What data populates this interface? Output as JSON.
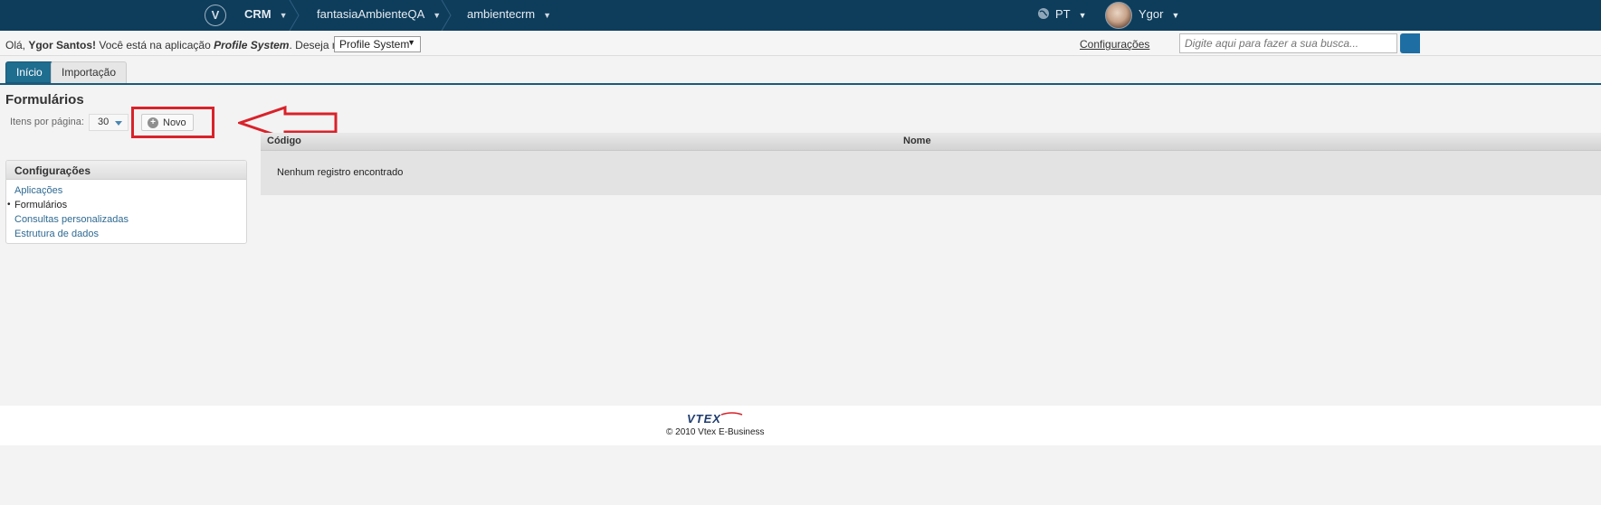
{
  "topbar": {
    "logo_letter": "V",
    "breadcrumbs": [
      {
        "label": "CRM"
      },
      {
        "label": "fantasiaAmbienteQA"
      },
      {
        "label": "ambientecrm"
      }
    ],
    "language": "PT",
    "user_name": "Ygor",
    "chevron": "⌄"
  },
  "infobar": {
    "greeting_prefix": "Olá, ",
    "user_full_name": "Ygor Santos!",
    "greeting_mid": " Você está na aplicação ",
    "app_name": "Profile System",
    "greeting_suffix": ". Deseja mudar?",
    "app_select_value": "Profile System",
    "config_link": "Configurações",
    "search_placeholder": "Digite aqui para fazer a sua busca..."
  },
  "tabs": [
    {
      "label": "Início",
      "active": true
    },
    {
      "label": "Importação",
      "active": false
    }
  ],
  "main": {
    "title": "Formulários",
    "per_page_label": "Itens por página:",
    "per_page_value": "30",
    "new_button": "Novo"
  },
  "sidebar": {
    "title": "Configurações",
    "items": [
      {
        "label": "Aplicações",
        "current": false
      },
      {
        "label": "Formulários",
        "current": true
      },
      {
        "label": "Consultas personalizadas",
        "current": false
      },
      {
        "label": "Estrutura de dados",
        "current": false
      }
    ]
  },
  "table": {
    "columns": [
      "Código",
      "Nome"
    ],
    "empty_message": "Nenhum registro encontrado"
  },
  "footer": {
    "logo_text": "VTEX",
    "copyright": "© 2010 Vtex E-Business"
  },
  "colors": {
    "topbar": "#0e3d5c",
    "tab_active": "#1f6d8f",
    "annotation": "#d9222a",
    "link": "#2e6a92"
  }
}
